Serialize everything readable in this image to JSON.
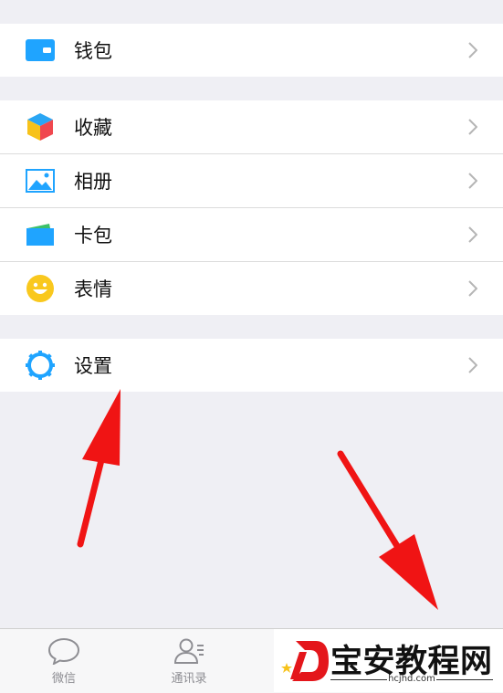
{
  "menu": {
    "wallet_label": "钱包",
    "favorites_label": "收藏",
    "album_label": "相册",
    "cards_label": "卡包",
    "stickers_label": "表情",
    "settings_label": "设置"
  },
  "tabbar": {
    "chats_label": "微信",
    "contacts_label": "通讯录"
  },
  "watermark": {
    "title": "宝安教程网",
    "url": "hcjhd.com"
  },
  "colors": {
    "background": "#efeff4",
    "accent": "#1fa4ff",
    "arrow": "#f01414"
  },
  "icons": {
    "wallet": "wallet-icon",
    "favorites": "cube-icon",
    "album": "picture-icon",
    "cards": "card-icon",
    "stickers": "smiley-icon",
    "settings": "gear-icon",
    "chevron": "chevron-right-icon",
    "chats": "chat-bubble-icon",
    "contacts": "contacts-icon"
  }
}
